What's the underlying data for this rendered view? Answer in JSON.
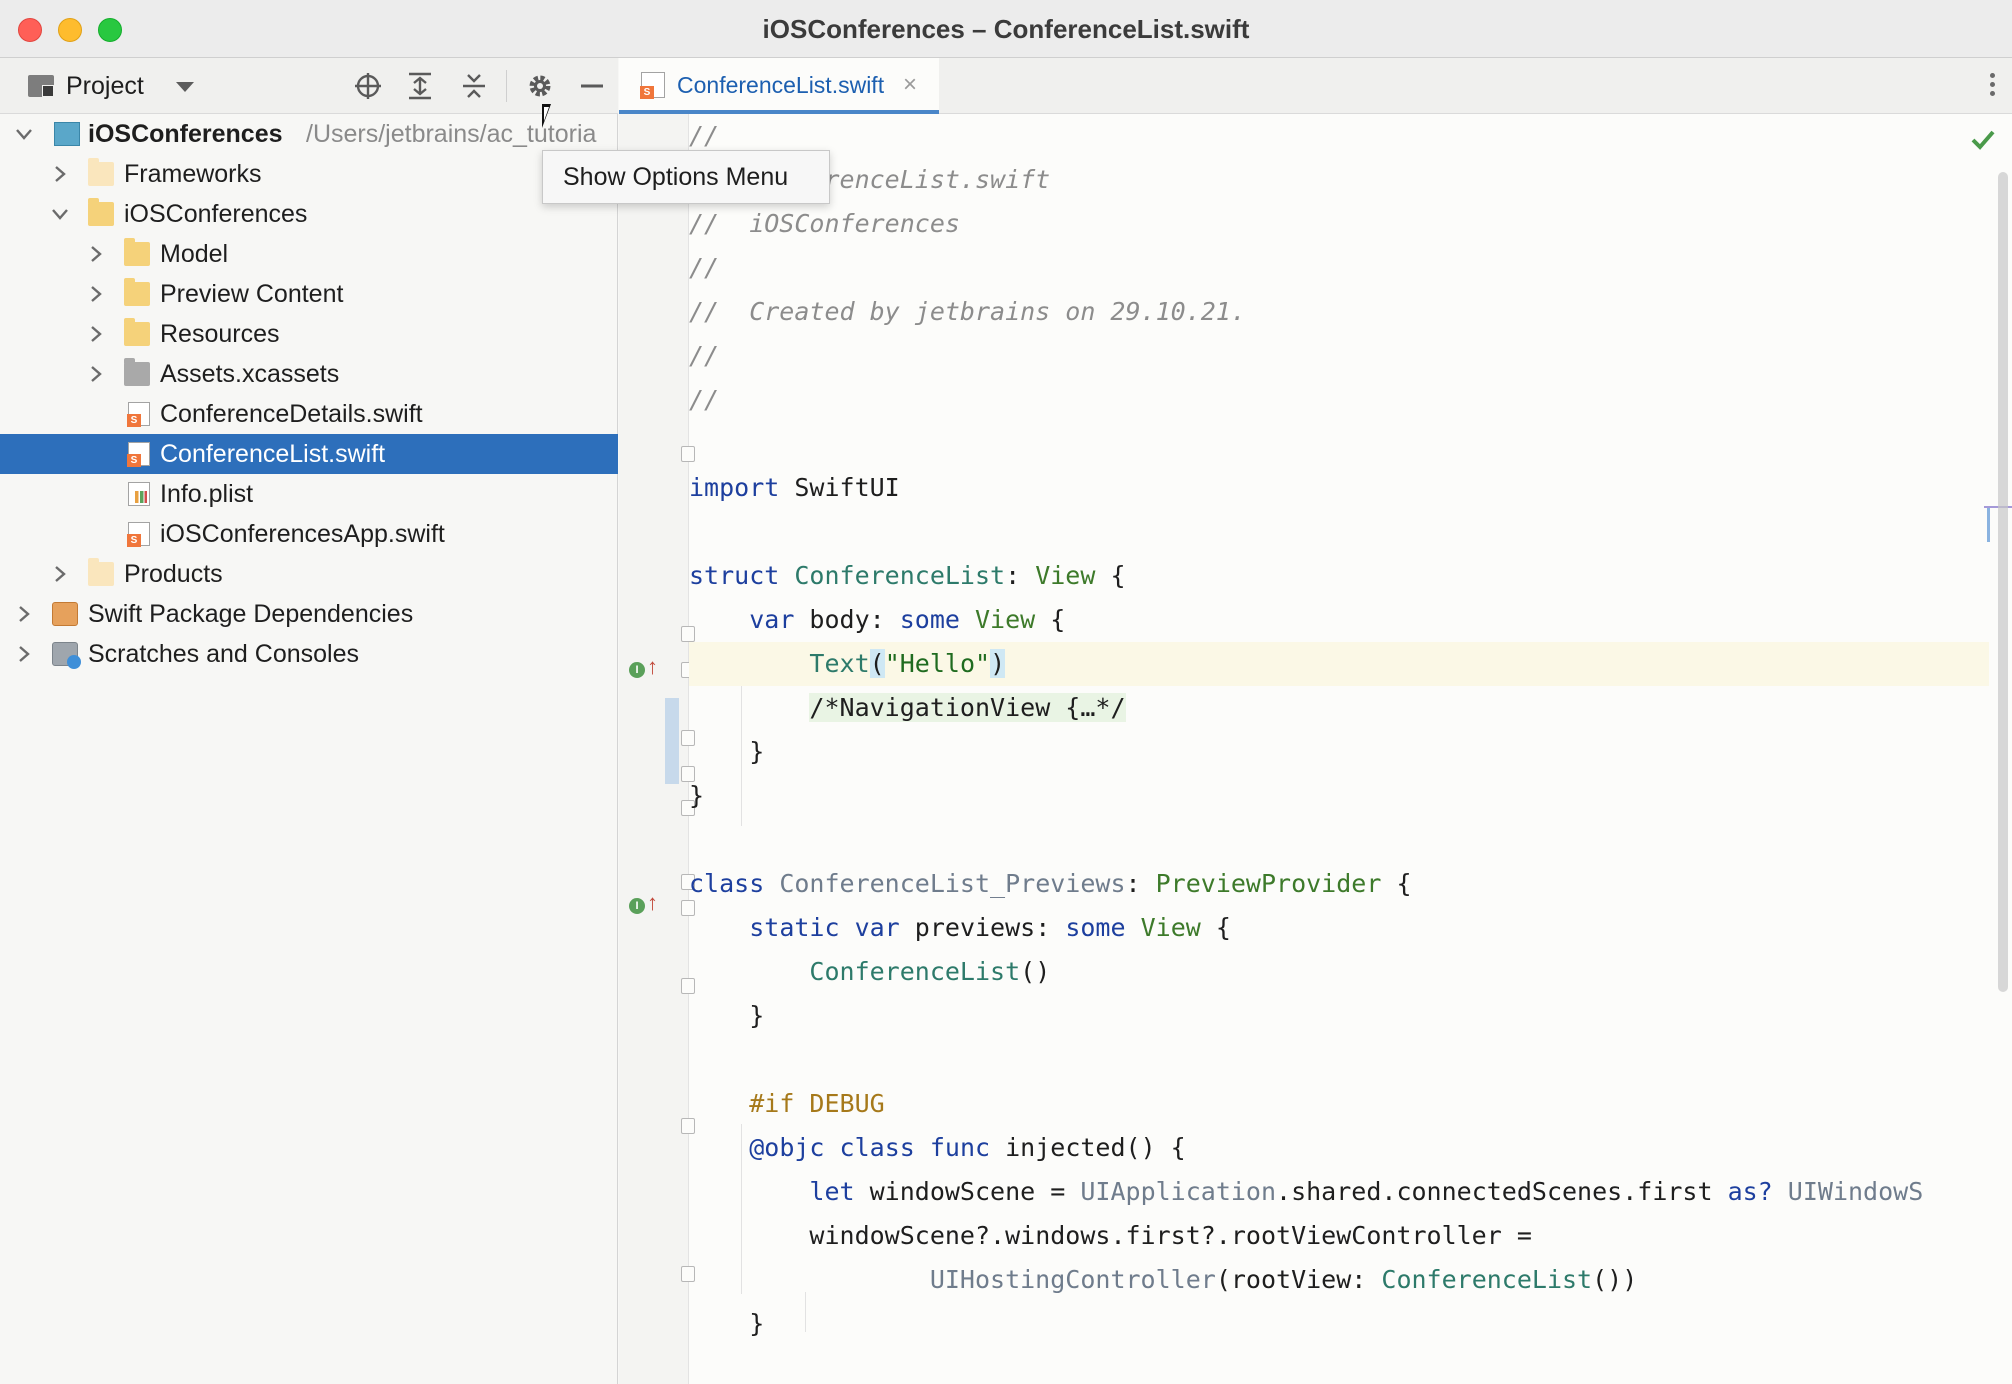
{
  "window": {
    "title": "iOSConferences – ConferenceList.swift"
  },
  "sidebar": {
    "toolbar": {
      "view_label": "Project"
    },
    "tooltip": "Show Options Menu",
    "tree": [
      {
        "label": "iOSConferences",
        "path": "/Users/jetbrains/ac_tutoria",
        "bold": true
      },
      {
        "label": "Frameworks"
      },
      {
        "label": "iOSConferences"
      },
      {
        "label": "Model"
      },
      {
        "label": "Preview Content"
      },
      {
        "label": "Resources"
      },
      {
        "label": "Assets.xcassets"
      },
      {
        "label": "ConferenceDetails.swift"
      },
      {
        "label": "ConferenceList.swift",
        "selected": true
      },
      {
        "label": "Info.plist"
      },
      {
        "label": "iOSConferencesApp.swift"
      },
      {
        "label": "Products"
      },
      {
        "label": "Swift Package Dependencies"
      },
      {
        "label": "Scratches and Consoles"
      }
    ]
  },
  "editor": {
    "tab": {
      "label": "ConferenceList.swift",
      "close": "×"
    },
    "code": {
      "l1": "//",
      "l2": "//  ConferenceList.swift",
      "l3": "//  iOSConferences",
      "l4": "//",
      "l5": "//  Created by jetbrains on 29.10.21.",
      "l6": "//",
      "l7": "//",
      "import_kw": "import",
      "import_mod": " SwiftUI",
      "struct_kw": "struct",
      "struct_name": " ConferenceList",
      "struct_colon": ": ",
      "struct_proto": "View",
      "struct_open": " {",
      "var_kw": "var",
      "body_name": " body: ",
      "some_kw": "some",
      "body_type": " View",
      "body_open": " {",
      "text_fn": "Text",
      "text_paren_open": "(",
      "text_str": "\"Hello\"",
      "text_paren_close": ")",
      "folded": "/*NavigationView {…*/",
      "close1": "}",
      "close2": "}",
      "class_kw": "class",
      "class_name": " ConferenceList_Previews",
      "class_colon": ": ",
      "class_proto": "PreviewProvider",
      "class_open": " {",
      "static_kw": "static",
      "var_kw2": " var",
      "previews_name": " previews: ",
      "some_kw2": "some",
      "previews_type": " View",
      "previews_open": " {",
      "conf_call": "ConferenceList",
      "conf_parens": "()",
      "close3": "}",
      "if_debug": "#if DEBUG",
      "objc_attr": "@objc",
      "class_kw2": " class",
      "func_kw": " func",
      "injected": " injected() {",
      "let_kw": "let",
      "ws_name": " windowScene = ",
      "uiapp": "UIApplication",
      "ws_rest": ".shared.connectedScenes.first ",
      "as_kw": "as?",
      "uiwin": " UIWindowS",
      "ws2": "windowScene?.windows.first?.rootViewController =",
      "uihost": "UIHostingController",
      "root_open": "(rootView: ",
      "conf_call2": "ConferenceList",
      "root_close": "())",
      "close4": "}"
    },
    "status": "no-problems"
  },
  "colors": {
    "selection": "#2d6fbb",
    "tab_accent": "#4a86c8",
    "keyword": "#1d3f9e",
    "type": "#2d7a6a",
    "comment": "#8c8c8c"
  }
}
